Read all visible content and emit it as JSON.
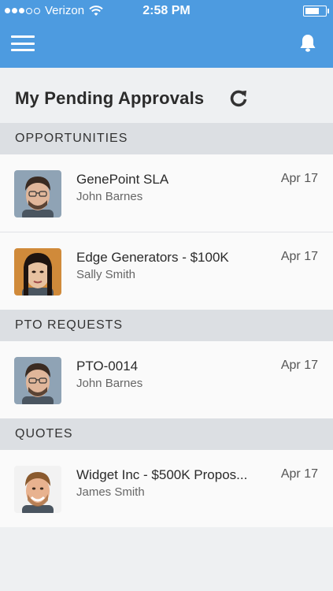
{
  "status_bar": {
    "carrier": "Verizon",
    "time": "2:58 PM",
    "signal_bars_filled": 3,
    "signal_bars_total": 5,
    "battery_level": 0.75
  },
  "colors": {
    "header_bg": "#4d9be0",
    "page_bg": "#eef0f2",
    "section_bg": "#dcdfe3",
    "row_bg": "#fafafa"
  },
  "navbar": {
    "menu_icon": "hamburger-menu-icon",
    "bell_icon": "bell-icon"
  },
  "page": {
    "title": "My Pending Approvals",
    "refresh_icon": "refresh-icon"
  },
  "sections": [
    {
      "title": "OPPORTUNITIES",
      "items": [
        {
          "title": "GenePoint SLA",
          "subtitle": "John Barnes",
          "date": "Apr 17",
          "avatar": "john-barnes"
        },
        {
          "title": "Edge Generators - $100K",
          "subtitle": "Sally Smith",
          "date": "Apr 17",
          "avatar": "sally-smith"
        }
      ]
    },
    {
      "title": "PTO REQUESTS",
      "items": [
        {
          "title": "PTO-0014",
          "subtitle": "John Barnes",
          "date": "Apr 17",
          "avatar": "john-barnes"
        }
      ]
    },
    {
      "title": "QUOTES",
      "items": [
        {
          "title": "Widget Inc - $500K Propos...",
          "subtitle": "James Smith",
          "date": "Apr 17",
          "avatar": "james-smith"
        }
      ]
    }
  ]
}
